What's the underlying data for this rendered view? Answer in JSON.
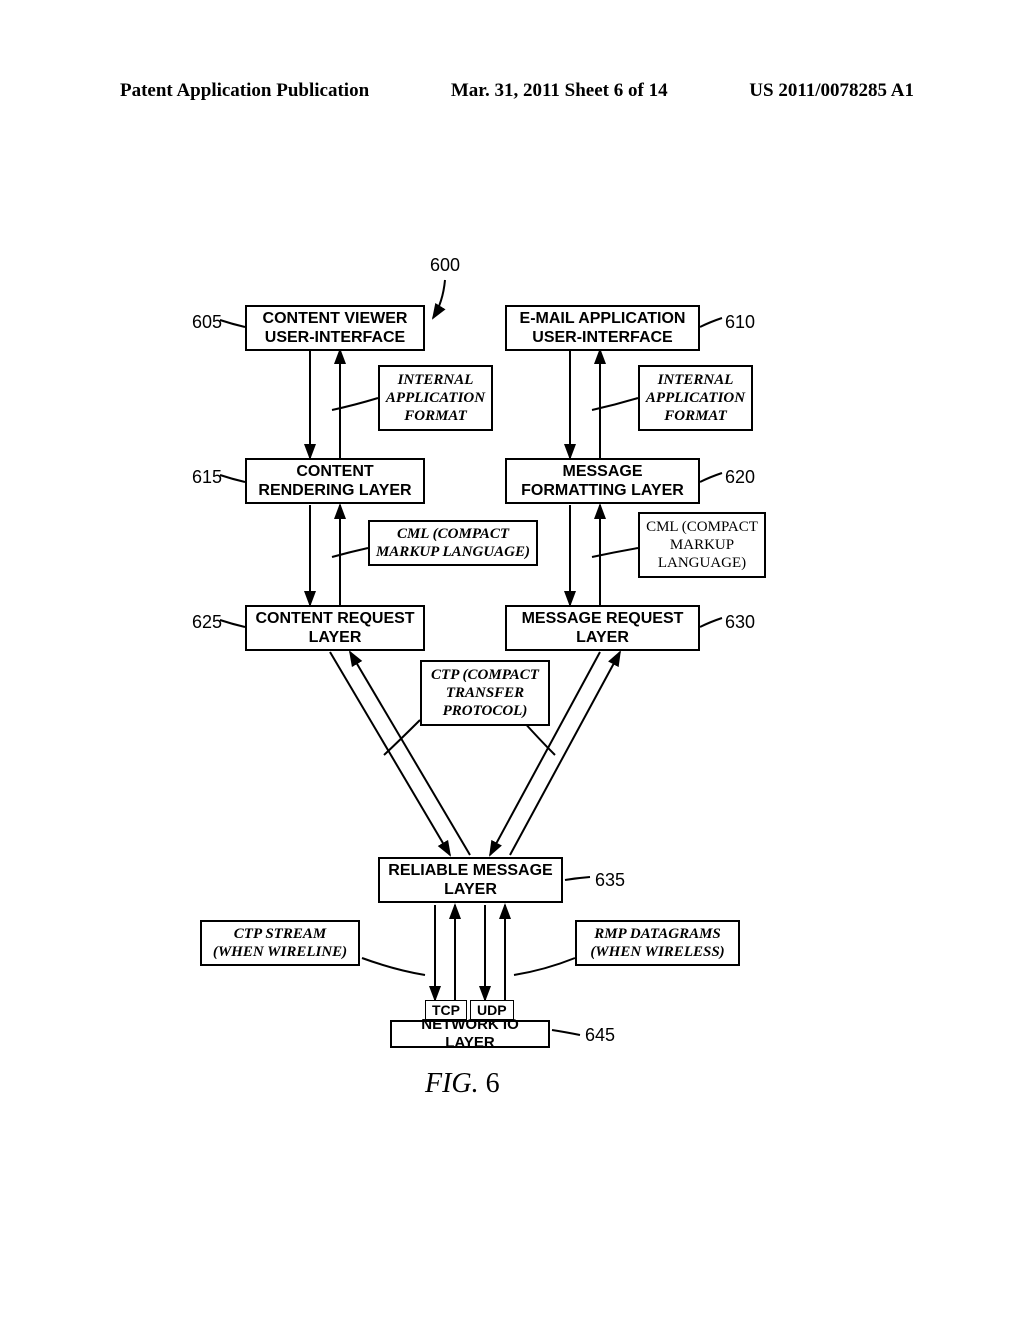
{
  "header": {
    "left": "Patent Application Publication",
    "middle": "Mar. 31, 2011  Sheet 6 of 14",
    "right": "US 2011/0078285 A1"
  },
  "refs": {
    "r600": "600",
    "r605": "605",
    "r610": "610",
    "r615": "615",
    "r620": "620",
    "r625": "625",
    "r630": "630",
    "r635": "635",
    "r645": "645"
  },
  "boxes": {
    "content_viewer_ui_l1": "CONTENT VIEWER",
    "content_viewer_ui_l2": "USER-INTERFACE",
    "email_app_ui_l1": "E-MAIL APPLICATION",
    "email_app_ui_l2": "USER-INTERFACE",
    "internal_app_format_l1": "INTERNAL",
    "internal_app_format_l2": "APPLICATION",
    "internal_app_format_l3": "FORMAT",
    "content_rendering_l1": "CONTENT",
    "content_rendering_l2": "RENDERING LAYER",
    "message_formatting_l1": "MESSAGE",
    "message_formatting_l2": "FORMATTING LAYER",
    "cml_left_l1": "CML (COMPACT",
    "cml_left_l2": "MARKUP LANGUAGE)",
    "cml_right_l1": "CML (COMPACT",
    "cml_right_l2": "MARKUP",
    "cml_right_l3": "LANGUAGE)",
    "content_request_l1": "CONTENT REQUEST",
    "content_request_l2": "LAYER",
    "message_request_l1": "MESSAGE REQUEST",
    "message_request_l2": "LAYER",
    "ctp_l1": "CTP (COMPACT",
    "ctp_l2": "TRANSFER",
    "ctp_l3": "PROTOCOL)",
    "reliable_message_l1": "RELIABLE MESSAGE",
    "reliable_message_l2": "LAYER",
    "ctp_stream_l1": "CTP STREAM",
    "ctp_stream_l2": "(WHEN WIRELINE)",
    "rmp_datagrams_l1": "RMP DATAGRAMS",
    "rmp_datagrams_l2": "(WHEN WIRELESS)",
    "tcp": "TCP",
    "udp": "UDP",
    "network_io": "NETWORK IO LAYER"
  },
  "figure_label": "FIG.",
  "figure_number": "6"
}
